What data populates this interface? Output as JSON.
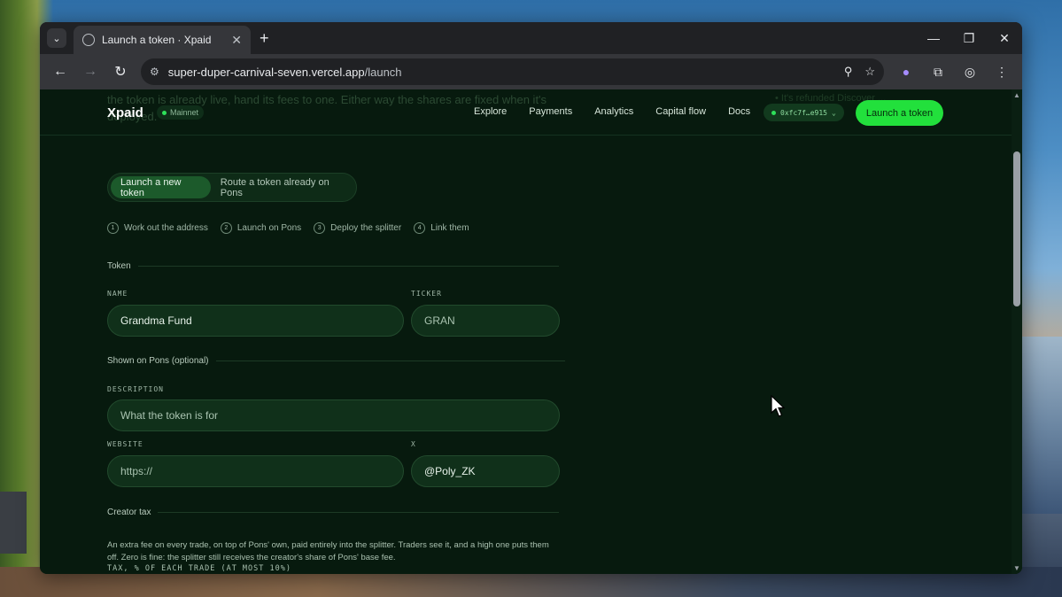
{
  "browser": {
    "tab_title": "Launch a token · Xpaid",
    "url_host": "super-duper-carnival-seven.vercel.app",
    "url_path": "/launch"
  },
  "ghost": {
    "text": "the token is already live, hand its fees to one. Either way the shares are fixed when it's deployed.",
    "right_text": "• It's refunded   Discover   ..."
  },
  "site": {
    "logo": "Xpaid",
    "network": "Mainnet",
    "nav": [
      "Explore",
      "Payments",
      "Analytics",
      "Capital flow",
      "Docs"
    ],
    "wallet": "0xfc7f…e915",
    "cta": "Launch a token"
  },
  "mode": {
    "options": [
      "Launch a new token",
      "Route a token already on Pons"
    ],
    "selected": "Launch a new token"
  },
  "steps": [
    {
      "n": "1",
      "label": "Work out the address"
    },
    {
      "n": "2",
      "label": "Launch on Pons"
    },
    {
      "n": "3",
      "label": "Deploy the splitter"
    },
    {
      "n": "4",
      "label": "Link them"
    }
  ],
  "form": {
    "token_section": "Token",
    "name_label": "NAME",
    "name_value": "Grandma Fund",
    "ticker_label": "TICKER",
    "ticker_value": "GRAN",
    "shown_section": "Shown on Pons (optional)",
    "description_label": "DESCRIPTION",
    "description_placeholder": "What the token is for",
    "website_label": "WEBSITE",
    "website_placeholder": "https://",
    "x_label": "X",
    "x_value": "@Poly_ZK",
    "tax_section": "Creator tax",
    "tax_paragraph": "An extra fee on every trade, on top of Pons' own, paid entirely into the splitter. Traders see it, and a high one puts them off. Zero is fine: the splitter still receives the creator's share of Pons' base fee.",
    "tax_caption": "TAX, % OF EACH TRADE (AT MOST 10%)"
  },
  "colors": {
    "accent": "#22e03c",
    "background": "#071a0e"
  }
}
